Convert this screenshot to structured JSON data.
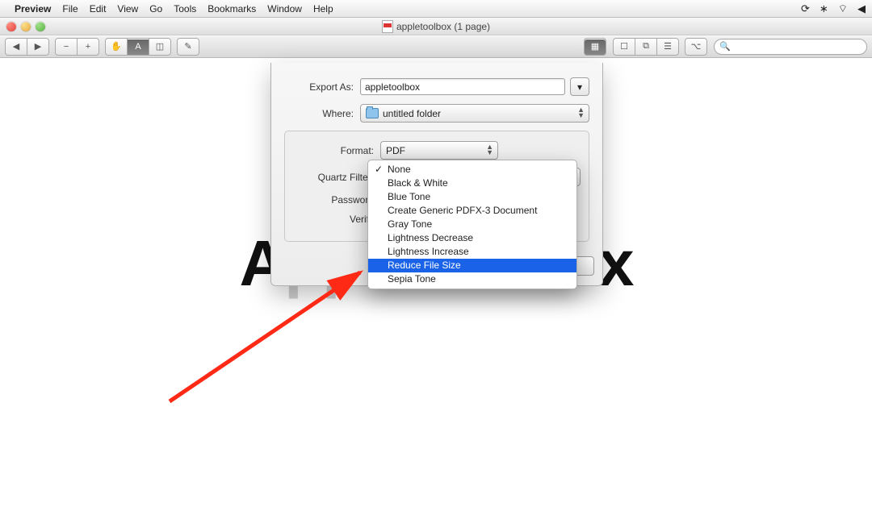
{
  "menubar": {
    "app_name": "Preview",
    "items": [
      "File",
      "Edit",
      "View",
      "Go",
      "Tools",
      "Bookmarks",
      "Window",
      "Help"
    ]
  },
  "window": {
    "title": "appletoolbox (1 page)"
  },
  "toolbar": {
    "nav": [
      "◀",
      "▶"
    ],
    "zoom": [
      "−",
      "+"
    ],
    "tools_hand": "✋",
    "tools_select_a": "A",
    "tools_marquee": "◫",
    "edit_pencil": "✎",
    "right_view": "▦",
    "right_layouts": [
      "☐",
      "⧉",
      "☰"
    ],
    "right_menu": "⌥",
    "search_placeholder": ""
  },
  "document": {
    "bg_lead": "A",
    "bg_mid": "ppletoolbo",
    "bg_tail": "x"
  },
  "sheet": {
    "export_as_label": "Export As:",
    "export_as_value": "appletoolbox",
    "disclosure": "▾",
    "where_label": "Where:",
    "where_value": "untitled folder",
    "format_label": "Format:",
    "format_value": "PDF",
    "quartz_label": "Quartz Filter:",
    "password_label": "Password",
    "verify_label": "Verify"
  },
  "quartz_menu": {
    "options": [
      "None",
      "Black & White",
      "Blue Tone",
      "Create Generic PDFX-3 Document",
      "Gray Tone",
      "Lightness Decrease",
      "Lightness Increase",
      "Reduce File Size",
      "Sepia Tone"
    ],
    "checked_index": 0,
    "selected_index": 7
  }
}
